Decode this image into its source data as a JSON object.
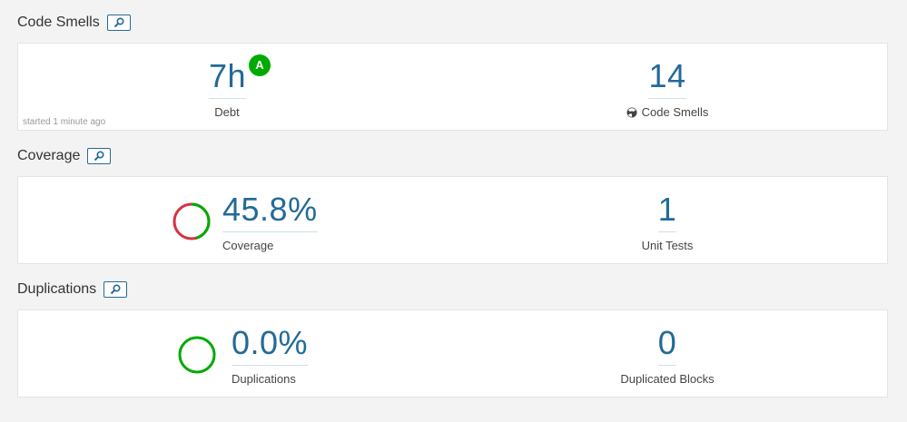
{
  "code_smells": {
    "title": "Code Smells",
    "debt": {
      "value": "7h",
      "label": "Debt",
      "rating": "A"
    },
    "smells": {
      "value": "14",
      "label": "Code Smells"
    },
    "started": "started 1 minute ago"
  },
  "coverage": {
    "title": "Coverage",
    "coverage": {
      "value": "45.8%",
      "label": "Coverage",
      "percent": 45.8
    },
    "unit_tests": {
      "value": "1",
      "label": "Unit Tests"
    }
  },
  "duplications": {
    "title": "Duplications",
    "duplications": {
      "value": "0.0%",
      "label": "Duplications",
      "percent": 0.0
    },
    "blocks": {
      "value": "0",
      "label": "Duplicated Blocks"
    }
  },
  "colors": {
    "link": "#236a97",
    "good": "#00aa00",
    "bad": "#d4333f"
  },
  "icons": {
    "drilldown": "search-icon",
    "code_smell": "radiation-icon"
  }
}
